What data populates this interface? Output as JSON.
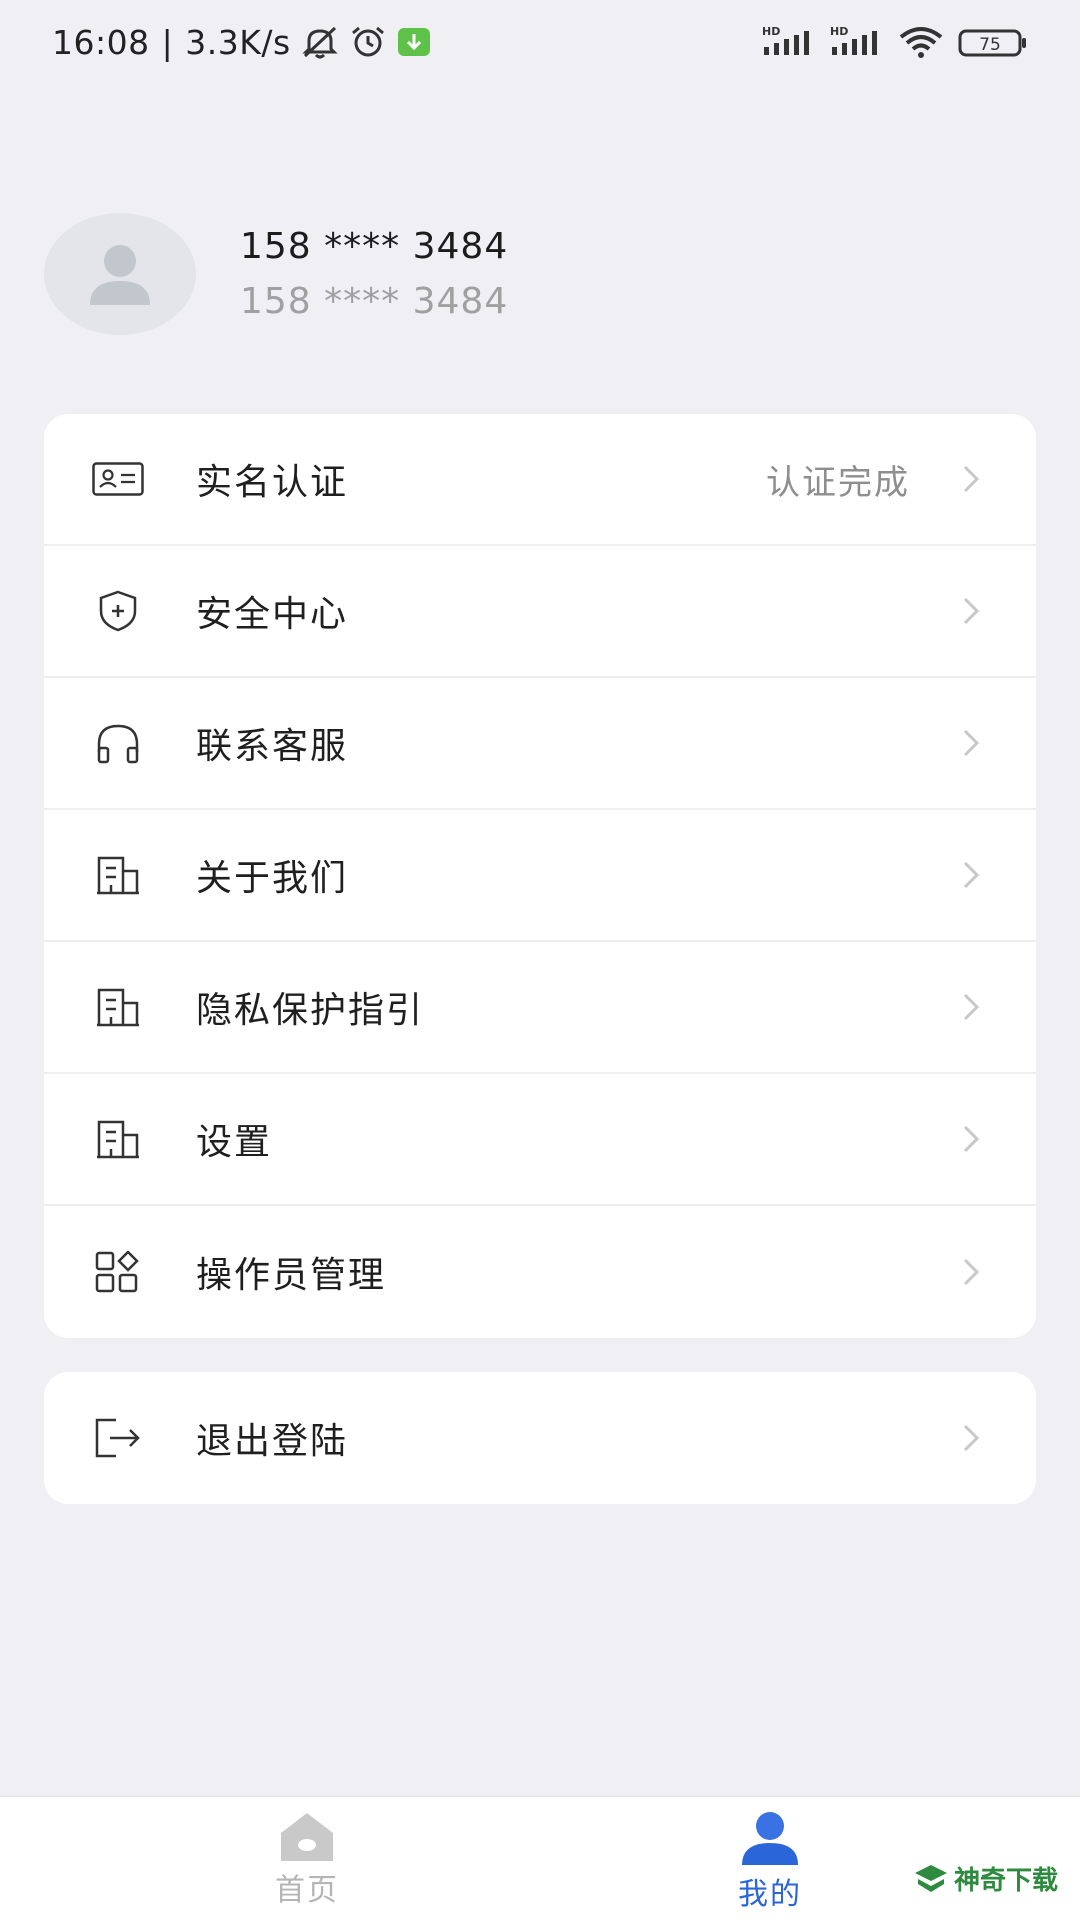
{
  "status_bar": {
    "time": "16:08",
    "separator": "|",
    "net_speed": "3.3K/s",
    "signal1_label": "HD",
    "signal2_label": "HD",
    "battery": "75",
    "icons": [
      "mute-icon",
      "alarm-icon",
      "download-notify-icon",
      "signal-icon",
      "wifi-icon",
      "battery-icon"
    ],
    "download_color": "#5ec248"
  },
  "profile": {
    "phone_primary": "158 **** 3484",
    "phone_secondary": "158 **** 3484"
  },
  "menu": {
    "items": [
      {
        "label": "实名认证",
        "value": "认证完成",
        "icon": "id-card-icon"
      },
      {
        "label": "安全中心",
        "value": "",
        "icon": "shield-icon"
      },
      {
        "label": "联系客服",
        "value": "",
        "icon": "headset-icon"
      },
      {
        "label": "关于我们",
        "value": "",
        "icon": "building-icon"
      },
      {
        "label": "隐私保护指引",
        "value": "",
        "icon": "building-icon"
      },
      {
        "label": "设置",
        "value": "",
        "icon": "building-icon"
      },
      {
        "label": "操作员管理",
        "value": "",
        "icon": "grid-icon"
      }
    ]
  },
  "logout": {
    "label": "退出登陆",
    "icon": "logout-icon"
  },
  "tabs": [
    {
      "label": "首页",
      "icon": "home-icon",
      "active": false
    },
    {
      "label": "我的",
      "icon": "user-icon",
      "active": true
    }
  ],
  "watermark": {
    "text": "神奇下载"
  },
  "colors": {
    "background": "#efeff4",
    "card": "#ffffff",
    "accent": "#2b66d9",
    "inactive_tab": "#b5b5b5",
    "secondary_text": "#8e8e8e"
  }
}
